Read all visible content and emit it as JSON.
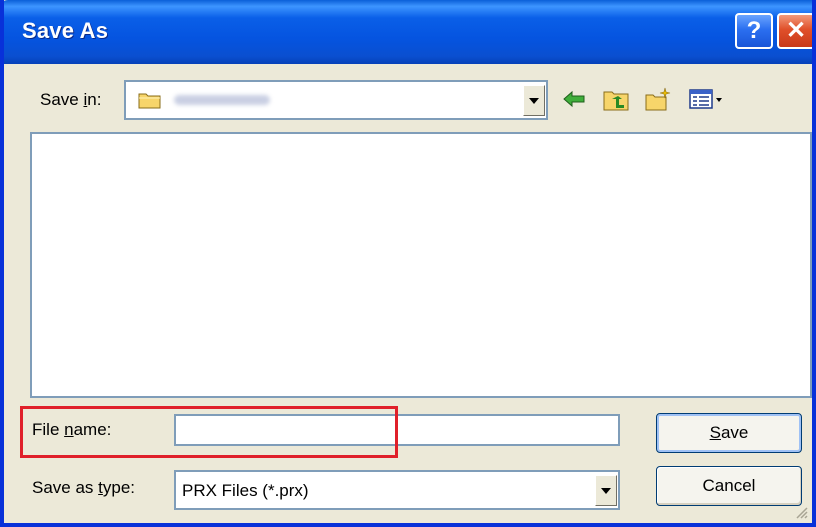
{
  "window": {
    "title": "Save As"
  },
  "titlebar": {
    "help_glyph": "?",
    "close_glyph": "✕"
  },
  "save_in": {
    "label_prefix": "Save ",
    "label_mnemonic": "i",
    "label_suffix": "n:",
    "folder_icon": "folder-icon",
    "folder_name": ""
  },
  "toolbar": {
    "icons": [
      "back-arrow-icon",
      "up-one-level-icon",
      "create-new-folder-icon",
      "views-menu-icon"
    ]
  },
  "file_name": {
    "label_prefix": "File ",
    "label_mnemonic": "n",
    "label_suffix": "ame:",
    "value": ""
  },
  "save_as_type": {
    "label_prefix": "Save as ",
    "label_mnemonic": "t",
    "label_suffix": "ype:",
    "selected": "PRX Files (*.prx)"
  },
  "buttons": {
    "save_mnemonic": "S",
    "save_rest": "ave",
    "cancel": "Cancel"
  },
  "colors": {
    "titlebar": "#0a5fd8",
    "dialog_bg": "#ece9d8",
    "highlight_box": "#e0202a",
    "field_border": "#7f9db9"
  }
}
